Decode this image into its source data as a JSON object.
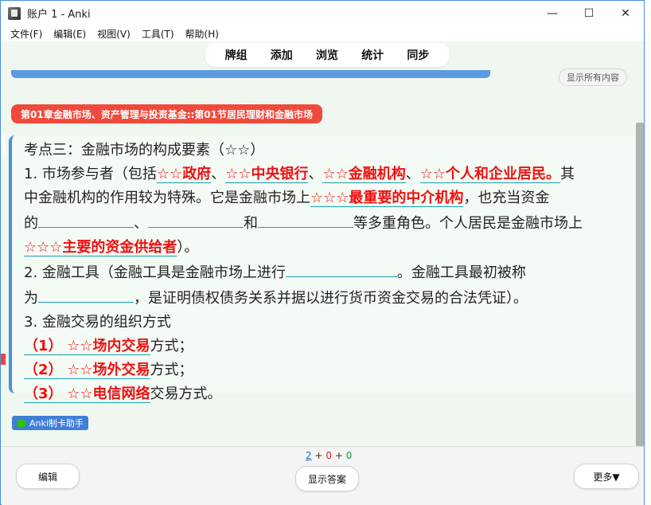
{
  "window": {
    "title": "账户 1 - Anki",
    "controls": [
      "—",
      "☐",
      "✕"
    ]
  },
  "menu": [
    "文件(F)",
    "编辑(E)",
    "视图(V)",
    "工具(T)",
    "帮助(H)"
  ],
  "toolbar": [
    "牌组",
    "添加",
    "浏览",
    "统计",
    "同步"
  ],
  "show_all_button": "显示所有内容",
  "deck_path": "第01章金融市场、资产管理与投资基金::第01节居民理财和金融市场",
  "card": {
    "title": "考点三：金融市场的构成要素（☆☆）",
    "p1_a": "1. 市场参与者（包括",
    "stars2": "☆☆",
    "stars3": "☆☆☆",
    "hl_gov": "政府",
    "sep1": "、",
    "hl_cb": "中央银行",
    "hl_fi": "金融机构",
    "hl_ind": "个人和企业居民。",
    "p1_b": "其",
    "p2_a": "中金融机构的作用较为特殊。它是金融市场上",
    "hl_mid": "最重要的中介机构",
    "p2_b": "，也充当资金",
    "p3_a": "的",
    "p3_and": "和",
    "p3_b": "等多重角色。个人居民是金融市场上",
    "hl_sup": "主要的资金供给者",
    "p4_b": "）。",
    "p5_a": "2. 金融工具（金融工具是金融市场上进行",
    "p5_b": "。金融工具最初被称",
    "p6_a": "为",
    "p6_b": "，是证明债权债务关系并据以进行货币资金交易的合法凭证）。",
    "p7": "3. 金融交易的组织方式",
    "n1": "（1）",
    "n2": "（2）",
    "n3": "（3）",
    "hl_in": "场内交易",
    "hl_out": "场外交易",
    "hl_tel": "电信网络",
    "mode": "方式；",
    "mode_last": "交易方式。"
  },
  "helper_label": "Anki制卡助手",
  "counts": {
    "new": "2",
    "learn": "0",
    "review": "0",
    "plus": "+"
  },
  "buttons": {
    "edit": "编辑",
    "show_answer": "显示答案",
    "more": "更多▼"
  },
  "colors": {
    "accent": "#4a90d9",
    "highlight": "#ee1111",
    "deck_badge": "#ef4a3c",
    "card_bg": "#eff7ef"
  }
}
